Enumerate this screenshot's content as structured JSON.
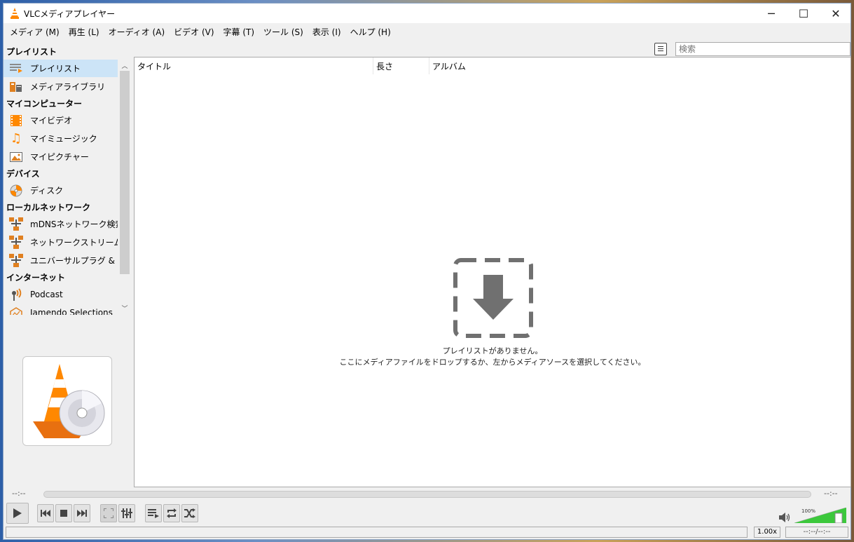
{
  "window": {
    "title": "VLCメディアプレイヤー",
    "minimize_glyph": "─",
    "maximize_glyph": "☐",
    "close_glyph": "✕"
  },
  "menu": [
    {
      "label": "メディア (M)"
    },
    {
      "label": "再生 (L)"
    },
    {
      "label": "オーディオ (A)"
    },
    {
      "label": "ビデオ (V)"
    },
    {
      "label": "字幕 (T)"
    },
    {
      "label": "ツール (S)"
    },
    {
      "label": "表示 (I)"
    },
    {
      "label": "ヘルプ (H)"
    }
  ],
  "sidebar": {
    "header_playlist": "プレイリスト",
    "header_computer": "マイコンピューター",
    "header_devices": "デバイス",
    "header_local_network": "ローカルネットワーク",
    "header_internet": "インターネット",
    "items": [
      {
        "label": "プレイリスト",
        "icon": "playlist-icon"
      },
      {
        "label": "メディアライブラリ",
        "icon": "media-library-icon"
      },
      {
        "label": "マイビデオ",
        "icon": "film-icon"
      },
      {
        "label": "マイミュージック",
        "icon": "music-note-icon"
      },
      {
        "label": "マイピクチャー",
        "icon": "picture-icon"
      },
      {
        "label": "ディスク",
        "icon": "disc-icon"
      },
      {
        "label": "mDNSネットワーク検索",
        "icon": "network-icon"
      },
      {
        "label": "ネットワークストリーム(SAP)",
        "icon": "network-icon"
      },
      {
        "label": "ユニバーサルプラグ & プ...",
        "icon": "network-icon"
      },
      {
        "label": "Podcast",
        "icon": "podcast-icon"
      },
      {
        "label": "Jamendo Selections",
        "icon": "jamendo-icon"
      }
    ]
  },
  "search": {
    "placeholder": "検索"
  },
  "playlist": {
    "columns": [
      "タイトル",
      "長さ",
      "アルバム"
    ],
    "empty_line1": "プレイリストがありません。",
    "empty_line2": "ここにメディアファイルをドロップするか、左からメディアソースを選択してください。"
  },
  "seek": {
    "elapsed": "--:--",
    "remaining": "--:--"
  },
  "controls": {
    "volume_label": "100%",
    "volume_level": 1.0
  },
  "status": {
    "speed": "1.00x",
    "time": "--:--/--:--"
  },
  "colors": {
    "accent": "#ff8800",
    "selected": "#cce4f7",
    "volume_green": "#3cc83c"
  }
}
